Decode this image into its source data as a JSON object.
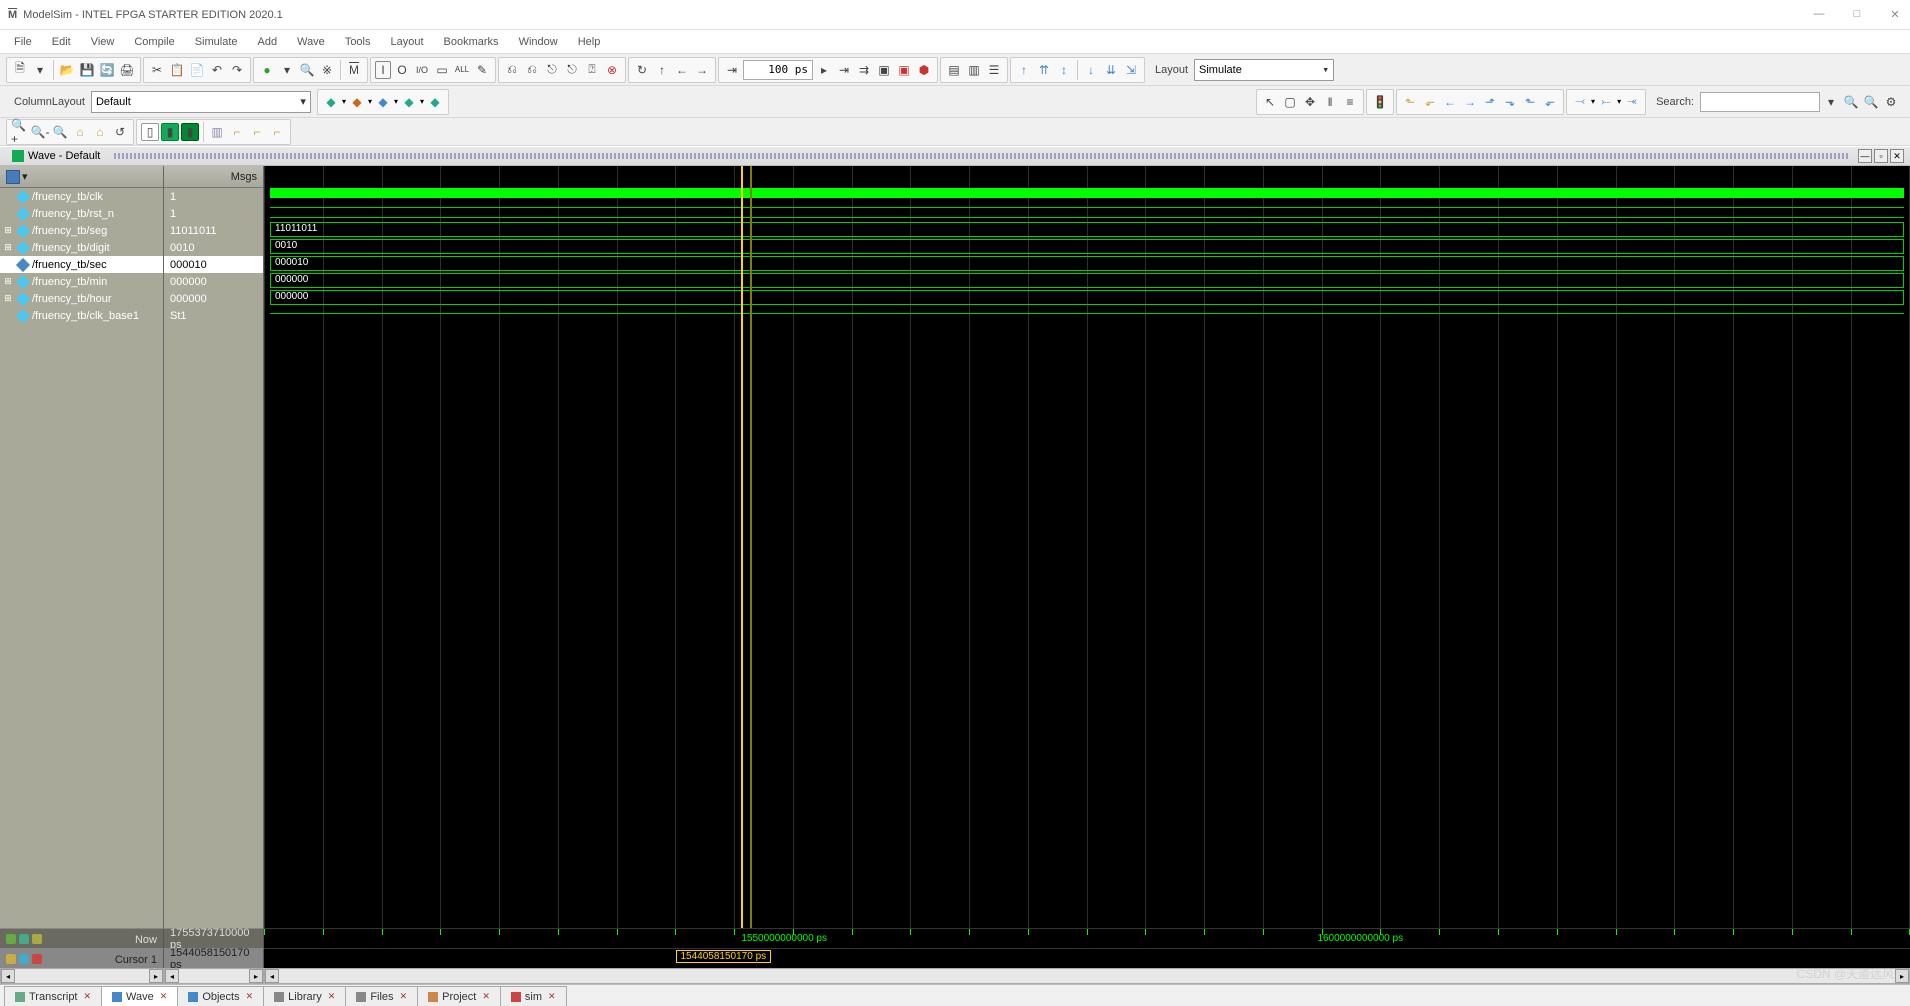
{
  "window": {
    "title": "ModelSim - INTEL FPGA STARTER EDITION 2020.1",
    "min": "—",
    "max": "□",
    "close": "✕"
  },
  "menus": [
    "File",
    "Edit",
    "View",
    "Compile",
    "Simulate",
    "Add",
    "Wave",
    "Tools",
    "Layout",
    "Bookmarks",
    "Window",
    "Help"
  ],
  "toolbar": {
    "layout_label": "Layout",
    "layout_value": "Simulate",
    "column_layout_label": "ColumnLayout",
    "column_layout_value": "Default",
    "time_value": "100 ps",
    "search_label": "Search:",
    "search_value": ""
  },
  "wave_tab": {
    "label": "Wave - Default"
  },
  "columns": {
    "signals_header": "",
    "msgs_header": "Msgs"
  },
  "signals": [
    {
      "name": "/fruency_tb/clk",
      "msg": "1",
      "expandable": false,
      "selected": false,
      "type": "high"
    },
    {
      "name": "/fruency_tb/rst_n",
      "msg": "1",
      "expandable": false,
      "selected": false,
      "type": "lineunder"
    },
    {
      "name": "/fruency_tb/seg",
      "msg": "11011011",
      "expandable": true,
      "selected": false,
      "type": "bus",
      "bus": "11011011"
    },
    {
      "name": "/fruency_tb/digit",
      "msg": "0010",
      "expandable": true,
      "selected": false,
      "type": "bus",
      "bus": "0010"
    },
    {
      "name": "/fruency_tb/sec",
      "msg": "000010",
      "expandable": true,
      "selected": true,
      "type": "bus",
      "bus": "000010"
    },
    {
      "name": "/fruency_tb/min",
      "msg": "000000",
      "expandable": true,
      "selected": false,
      "type": "bus",
      "bus": "000000"
    },
    {
      "name": "/fruency_tb/hour",
      "msg": "000000",
      "expandable": true,
      "selected": false,
      "type": "bus",
      "bus": "000000"
    },
    {
      "name": "/fruency_tb/clk_base1",
      "msg": "St1",
      "expandable": false,
      "selected": false,
      "type": "line"
    }
  ],
  "time": {
    "now_label": "Now",
    "now_value": "1755373710000 ps",
    "cursor_label": "Cursor 1",
    "cursor_value": "1544058150170 ps",
    "cursor_box": "1544058150170 ps",
    "ticks": [
      {
        "pos": 29,
        "label": "1550000000000 ps"
      },
      {
        "pos": 64,
        "label": "1600000000000 ps"
      }
    ],
    "cursor_pos_pct": 29.0
  },
  "tabs": [
    {
      "label": "Transcript",
      "active": false,
      "icon": "#6a8"
    },
    {
      "label": "Wave",
      "active": true,
      "icon": "#48c"
    },
    {
      "label": "Objects",
      "active": false,
      "icon": "#48c"
    },
    {
      "label": "Library",
      "active": false,
      "icon": "#888"
    },
    {
      "label": "Files",
      "active": false,
      "icon": "#888"
    },
    {
      "label": "Project",
      "active": false,
      "icon": "#c84"
    },
    {
      "label": "sim",
      "active": false,
      "icon": "#c44"
    }
  ],
  "watermark": "CSDN @天道远风"
}
